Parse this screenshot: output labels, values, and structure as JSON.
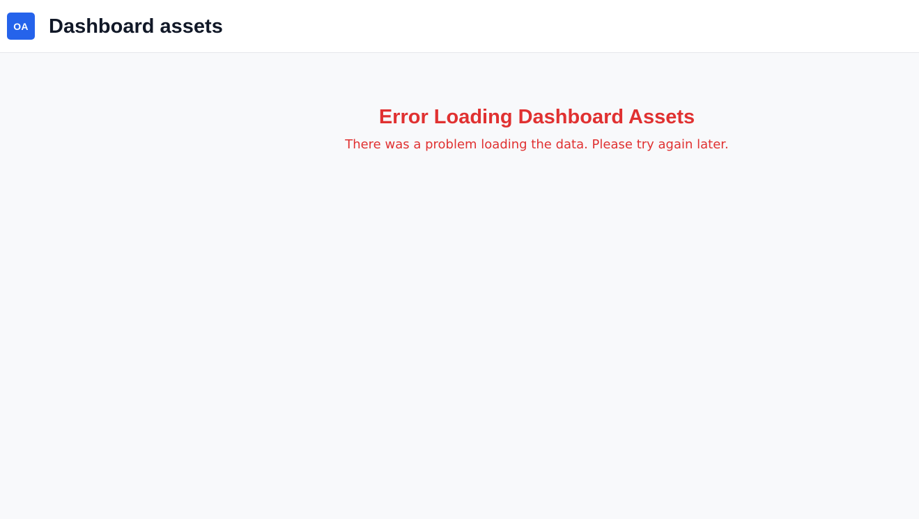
{
  "header": {
    "logo_text": "OA",
    "title": "Dashboard assets"
  },
  "error": {
    "title": "Error Loading Dashboard Assets",
    "message": "There was a problem loading the data. Please try again later."
  },
  "colors": {
    "brand_blue": "#2563eb",
    "error_red": "#e03131",
    "page_background": "#f8f9fb",
    "header_background": "#ffffff",
    "title_text": "#111827"
  }
}
